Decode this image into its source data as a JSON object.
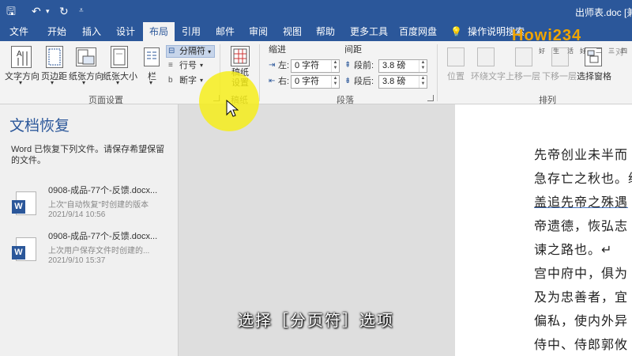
{
  "titlebar": {
    "save_icon": "save-icon",
    "undo_icon": "undo-icon",
    "redo_icon": "redo-icon",
    "customize_icon": "customize-icon",
    "doc_title": "出师表.doc [兼容"
  },
  "menu": {
    "tabs": [
      "文件",
      "开始",
      "插入",
      "设计",
      "布局",
      "引用",
      "邮件",
      "审阅",
      "视图",
      "帮助",
      "更多工具",
      "百度网盘"
    ],
    "active": "布局",
    "tell_me": "操作说明搜索"
  },
  "ribbon": {
    "page_setup": {
      "text_direction": "文字方向",
      "margins": "页边距",
      "orientation": "纸张方向",
      "size": "纸张大小",
      "columns": "栏",
      "breaks": "分隔符",
      "line_numbers": "行号",
      "hyphenation": "断字",
      "label": "页面设置"
    },
    "manuscript": {
      "setup": "稿纸设置",
      "label": "稿纸"
    },
    "paragraph": {
      "indent_header": "缩进",
      "spacing_header": "间距",
      "left_label": "左:",
      "left_value": "0 字符",
      "right_label": "右:",
      "right_value": "0 字符",
      "before_label": "段前:",
      "before_value": "3.8 磅",
      "after_label": "段后:",
      "after_value": "3.8 磅",
      "label": "段落"
    },
    "arrange": {
      "position": "位置",
      "wrap_text": "环绕文字",
      "bring_forward": "上移一层",
      "send_backward": "下移一层",
      "selection_pane": "选择窗格",
      "align": "对",
      "label": "排列"
    }
  },
  "recovery": {
    "title": "文档恢复",
    "description": "Word 已恢复下列文件。请保存希望保留的文件。",
    "files": [
      {
        "name": "0908-成品-77个-反馈.docx...",
        "note": "上次\"自动恢复\"时创建的版本",
        "date": "2021/9/14 10:56"
      },
      {
        "name": "0908-成品-77个-反馈.docx...",
        "note": "上次用户保存文件时创建的...",
        "date": "2021/9/10 15:37"
      }
    ]
  },
  "document": {
    "lines": [
      "先帝创业未半而",
      "急存亡之秋也。绵",
      "盖追先帝之殊遇",
      "帝遗德，恢弘志",
      "谏之路也。↵",
      "宫中府中，俱为",
      "及为忠善者，宜",
      "偏私，使内外异",
      "侍中、侍郎郭攸"
    ]
  },
  "overlay": {
    "subtitle": "选择［分页符］选项",
    "logo": "Howi234",
    "logo_chars": [
      "好",
      "生",
      "活",
      "好",
      "二",
      "三",
      "四"
    ]
  },
  "colors": {
    "accent": "#2b579a",
    "highlight": "#f6ee14",
    "logo": "#f0a400"
  }
}
